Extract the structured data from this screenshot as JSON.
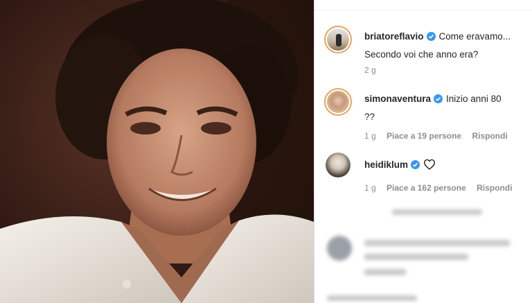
{
  "comments": [
    {
      "username": "briatoreflavio",
      "text_line1": "Come eravamo...",
      "text_line2": "Secondo voi che anno era?",
      "time": "2 g"
    },
    {
      "username": "simonaventura",
      "text_line1": "Inizio anni 80",
      "text_line2": "??",
      "time": "1 g",
      "likes": "Piace a 19 persone",
      "reply": "Rispondi"
    },
    {
      "username": "heidiklum",
      "time": "1 g",
      "likes": "Piace a 162 persone",
      "reply": "Rispondi"
    }
  ],
  "colors": {
    "verified": "#3897f0",
    "username": "#262626",
    "meta": "#8e8e8e",
    "ring": "#e9a35b"
  },
  "icons": [
    "verified-badge-icon",
    "heart-icon"
  ]
}
